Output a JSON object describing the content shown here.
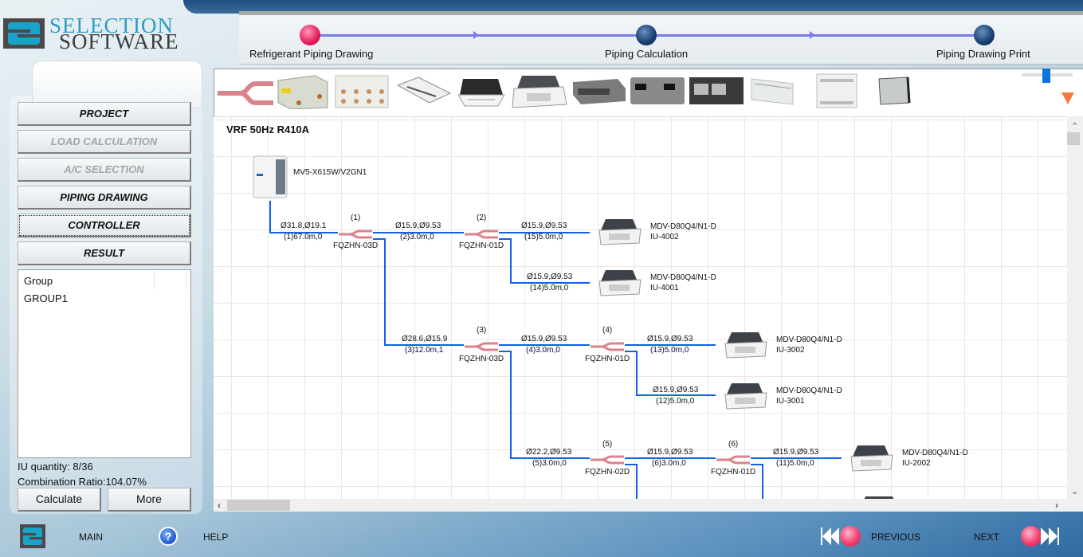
{
  "app": {
    "logo_line1": "SELECTION",
    "logo_line2": "SOFTWARE"
  },
  "workflow_steps": [
    {
      "label": "Refrigerant Piping Drawing",
      "state": "active"
    },
    {
      "label": "Piping Calculation",
      "state": "inactive"
    },
    {
      "label": "Piping Drawing Print",
      "state": "inactive"
    }
  ],
  "sidebar": {
    "nav": [
      {
        "label": "PROJECT",
        "enabled": true
      },
      {
        "label": "LOAD CALCULATION",
        "enabled": false
      },
      {
        "label": "A/C SELECTION",
        "enabled": false
      },
      {
        "label": "PIPING DRAWING",
        "enabled": true
      },
      {
        "label": "CONTROLLER",
        "enabled": true,
        "focused": true
      },
      {
        "label": "RESULT",
        "enabled": true
      }
    ],
    "group_list": {
      "header": "Group",
      "items": [
        "GROUP1"
      ]
    },
    "iu_quantity": "IU quantity: 8/36",
    "combination_ratio": "Combination Ratio:104.07%",
    "calculate_label": "Calculate",
    "more_label": "More"
  },
  "toolbar": {
    "components": [
      "branch-joint",
      "mode-switch-box",
      "multi-port-box",
      "one-way-cassette",
      "compact-cassette",
      "four-way-cassette",
      "slim-duct",
      "medium-duct",
      "high-static-duct",
      "ceiling-floor",
      "console",
      "floor-standing"
    ],
    "zoom_level": 0.5
  },
  "diagram": {
    "title": "VRF 50Hz R410A",
    "outdoor_unit": "MV5-X615W/V2GN1",
    "branches": [
      {
        "id": "(1)",
        "model": "FQZHN-03D"
      },
      {
        "id": "(2)",
        "model": "FQZHN-01D"
      },
      {
        "id": "(3)",
        "model": "FQZHN-03D"
      },
      {
        "id": "(4)",
        "model": "FQZHN-01D"
      },
      {
        "id": "(5)",
        "model": "FQZHN-02D"
      },
      {
        "id": "(6)",
        "model": "FQZHN-01D"
      }
    ],
    "pipes": [
      {
        "size": "Ø31.8,Ø19.1",
        "len": "(1)67.0m,0"
      },
      {
        "size": "Ø15.9,Ø9.53",
        "len": "(2)3.0m,0"
      },
      {
        "size": "Ø15.9,Ø9.53",
        "len": "(15)5.0m,0"
      },
      {
        "size": "Ø15.9,Ø9.53",
        "len": "(14)5.0m,0"
      },
      {
        "size": "Ø28.6,Ø15.9",
        "len": "(3)12.0m,1"
      },
      {
        "size": "Ø15.9,Ø9.53",
        "len": "(4)3.0m,0"
      },
      {
        "size": "Ø15.9,Ø9.53",
        "len": "(13)5.0m,0"
      },
      {
        "size": "Ø15.9,Ø9.53",
        "len": "(12)5.0m,0"
      },
      {
        "size": "Ø22.2,Ø9.53",
        "len": "(5)3.0m,0"
      },
      {
        "size": "Ø15.9,Ø9.53",
        "len": "(6)3.0m,0"
      },
      {
        "size": "Ø15.9,Ø9.53",
        "len": "(11)5.0m,0"
      }
    ],
    "indoor_units": [
      {
        "model": "MDV-D80Q4/N1-D",
        "name": "IU-4002"
      },
      {
        "model": "MDV-D80Q4/N1-D",
        "name": "IU-4001"
      },
      {
        "model": "MDV-D80Q4/N1-D",
        "name": "IU-3002"
      },
      {
        "model": "MDV-D80Q4/N1-D",
        "name": "IU-3001"
      },
      {
        "model": "MDV-D80Q4/N1-D",
        "name": "IU-2002"
      }
    ]
  },
  "bottom_nav": {
    "main": "MAIN",
    "help": "HELP",
    "previous": "PREVIOUS",
    "next": "NEXT"
  },
  "colors": {
    "pipe": "#1060e8",
    "active_step": "#e51a5a",
    "inactive_step": "#163d70",
    "brand": "#2a9cc5"
  }
}
